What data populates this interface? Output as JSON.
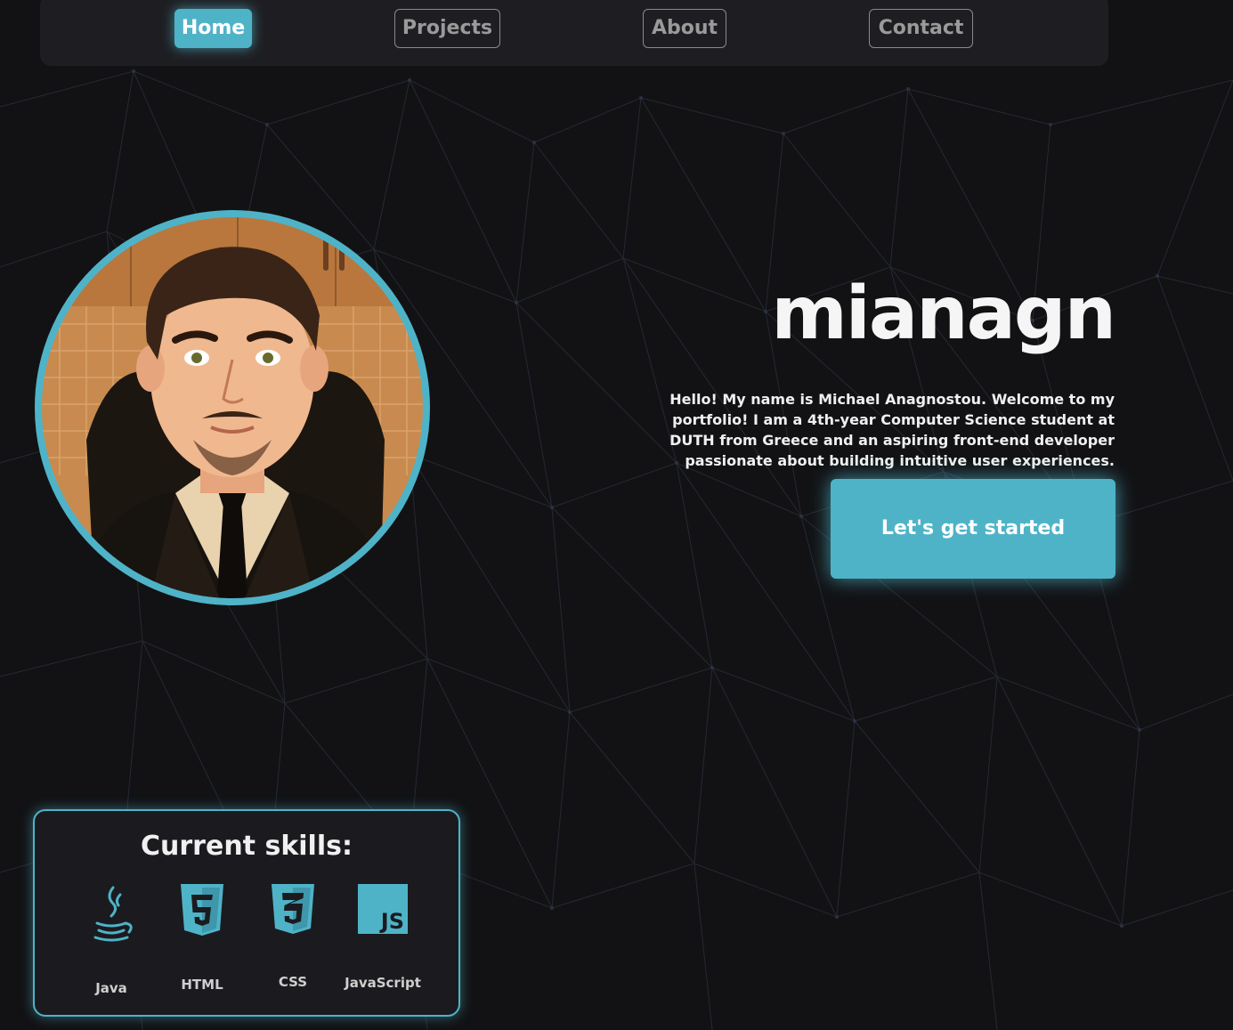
{
  "nav": {
    "items": [
      {
        "label": "Home",
        "active": true
      },
      {
        "label": "Projects",
        "active": false
      },
      {
        "label": "About",
        "active": false
      },
      {
        "label": "Contact",
        "active": false
      }
    ]
  },
  "hero": {
    "title": "mianagn",
    "description": "Hello! My name is Michael Anagnostou. Welcome to my portfolio! I am a 4th-year Computer Science student at DUTH from Greece and an aspiring front-end developer passionate about building intuitive user experiences.",
    "cta_label": "Let's get started"
  },
  "skills": {
    "title": "Current skills:",
    "items": [
      {
        "label": "Java",
        "icon": "java-icon"
      },
      {
        "label": "HTML",
        "icon": "html5-icon"
      },
      {
        "label": "CSS",
        "icon": "css3-icon"
      },
      {
        "label": "JavaScript",
        "icon": "javascript-icon"
      }
    ]
  },
  "theme": {
    "accent": "#4fb3c8",
    "background": "#121214",
    "panel": "#1e1e22"
  }
}
